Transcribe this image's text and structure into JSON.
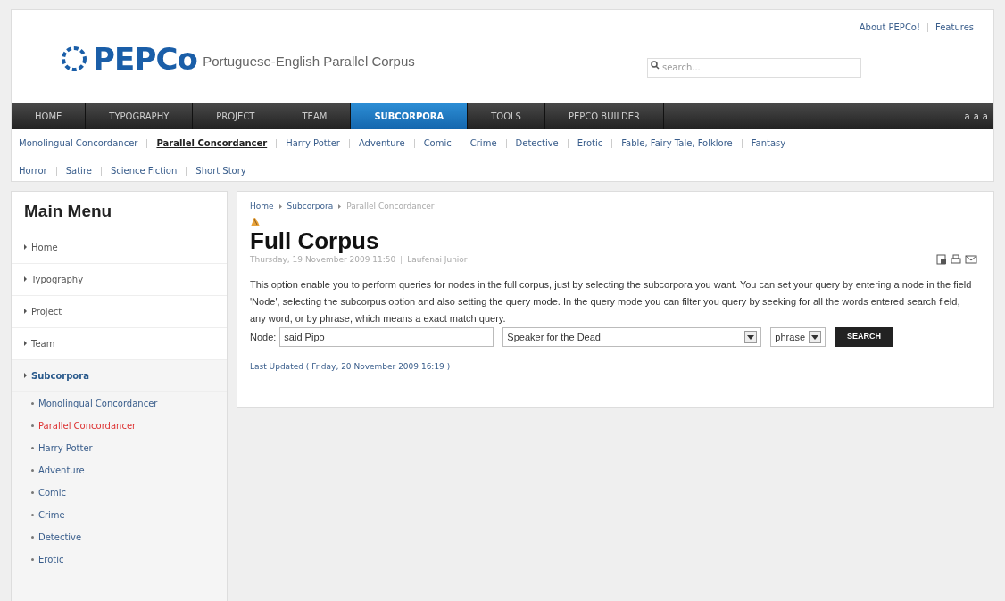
{
  "header": {
    "logo_mark": "PEPCo",
    "tagline": "Portuguese-English Parallel Corpus",
    "search": {
      "placeholder": "search..."
    },
    "top_links": [
      "About PEPCo!",
      "Features"
    ],
    "font_sizer": [
      "a",
      "a",
      "a"
    ]
  },
  "nav": [
    {
      "label": "HOME",
      "selected": false
    },
    {
      "label": "TYPOGRAPHY",
      "selected": false
    },
    {
      "label": "PROJECT",
      "selected": false
    },
    {
      "label": "TEAM",
      "selected": false
    },
    {
      "label": "SUBCORPORA",
      "selected": true
    },
    {
      "label": "TOOLS",
      "selected": false
    },
    {
      "label": "PEPCO BUILDER",
      "selected": false
    }
  ],
  "subnav": [
    {
      "label": "Monolingual Concordancer",
      "selected": false
    },
    {
      "label": "Parallel Concordancer",
      "selected": true
    },
    {
      "label": "Harry Potter",
      "selected": false
    },
    {
      "label": "Adventure",
      "selected": false
    },
    {
      "label": "Comic",
      "selected": false
    },
    {
      "label": "Crime",
      "selected": false
    },
    {
      "label": "Detective",
      "selected": false
    },
    {
      "label": "Erotic",
      "selected": false
    },
    {
      "label": "Fable, Fairy Tale, Folklore",
      "selected": false
    },
    {
      "label": "Fantasy",
      "selected": false
    },
    {
      "label": "Horror",
      "selected": false
    },
    {
      "label": "Satire",
      "selected": false
    },
    {
      "label": "Science Fiction",
      "selected": false
    },
    {
      "label": "Short Story",
      "selected": false
    }
  ],
  "sidebar": {
    "title": "Main Menu",
    "items": [
      {
        "label": "Home",
        "selected": false
      },
      {
        "label": "Typography",
        "selected": false
      },
      {
        "label": "Project",
        "selected": false
      },
      {
        "label": "Team",
        "selected": false
      },
      {
        "label": "Subcorpora",
        "selected": true,
        "children": [
          {
            "label": "Monolingual Concordancer",
            "selected": false
          },
          {
            "label": "Parallel Concordancer",
            "selected": true
          },
          {
            "label": "Harry Potter",
            "selected": false
          },
          {
            "label": "Adventure",
            "selected": false
          },
          {
            "label": "Comic",
            "selected": false
          },
          {
            "label": "Crime",
            "selected": false
          },
          {
            "label": "Detective",
            "selected": false
          },
          {
            "label": "Erotic",
            "selected": false
          }
        ]
      }
    ]
  },
  "article": {
    "breadcrumbs": [
      "Home",
      "Subcorpora",
      "Parallel Concordancer"
    ],
    "title": "Full Corpus",
    "meta_date": "Thursday, 19 November 2009 11:50",
    "meta_author": "Laufenai Junior",
    "body": "This option enable you to perform queries for nodes in the full corpus, just by selecting the subcorpora you want. You can set your query by entering a node in the field 'Node', selecting the subcorpus option and also setting the query mode. In the query mode you can filter you query by seeking for all the words entered search field, any word, or by phrase, which means a exact match query.",
    "form": {
      "node_label": "Node:",
      "node_value": "said Pipo",
      "subcorpus": "Speaker for the Dead",
      "mode": "phrase",
      "button": "SEARCH"
    },
    "last_updated": "Last Updated ( Friday, 20 November 2009 16:19 )"
  }
}
